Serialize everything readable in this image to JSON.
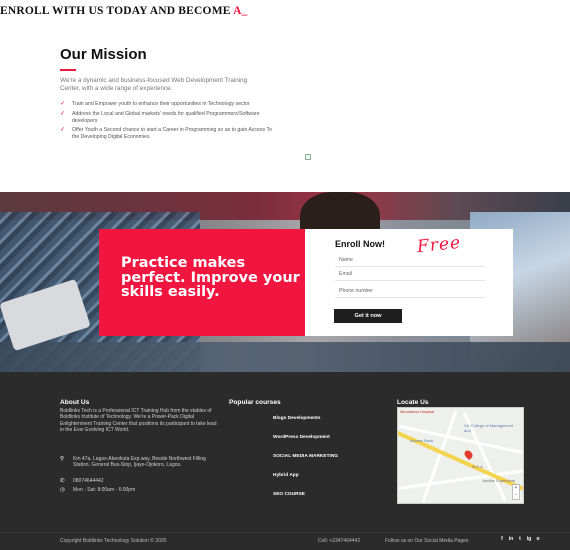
{
  "marquee": {
    "text": "ENROLL WITH US TODAY AND BECOME ",
    "accent": "A_"
  },
  "mission": {
    "title": "Our Mission",
    "intro": "We're a dynamic and business-focused Web Development Training Center, with a wide range of experience.",
    "items": [
      "Train and Empower youth to enhance their opportunities in Technology sector",
      "Address the Local and Global markets' needs for qualified Programmers/Software developers",
      "Offer Youth a Second chance to start a Career in Programming so as to gain Access To the Developing Digital Economies"
    ]
  },
  "hero": {
    "practice_text": "Practice makes perfect. Improve your skills easily.",
    "enroll_title": "Enroll Now!",
    "free_text": "Free",
    "fields": {
      "name": "Name",
      "email": "Email",
      "phone": "Phone number"
    },
    "button": "Get it now"
  },
  "footer": {
    "about_head": "About Us",
    "about_text": "Boldlinks Tech is a Professional ICT Training Hub from the stables of Boldlinks Institute of Technology. We're a Power-Pack Digital Enlightenment Training Center that positions its participant to take lead in the Ever Evolving ICT World.",
    "address": "Km 47a, Lagos-Abeokuta Exp.way, Beside Northwest Filling Station, General Bus-Stop, Ijaye-Ojokoro, Lagos.",
    "phone": "08074644442",
    "hours": "Mon - Sat: 8:00am - 6:00pm",
    "popular_head": "Popular courses",
    "courses": [
      "Blogs Developments",
      "WordPress Development",
      "SOCIAL MEDIA MARKETING",
      "Hybrid App",
      "SEO COURSE"
    ],
    "locate_head": "Locate Us",
    "map_labels": {
      "hospital": "Mimaduna Hospital",
      "college": "Vic College of Management and",
      "bank": "Access Bank",
      "mesa": "M.E.A",
      "store": "Jamilat Superstore"
    },
    "copyright": "Copyright Boldlinks Technology Solution © 2020",
    "cell": "Cell: +2347464442",
    "follow": "Follow us on Our Social Media Pages",
    "socials": [
      "f",
      "in",
      "t",
      "ig",
      "o"
    ]
  }
}
